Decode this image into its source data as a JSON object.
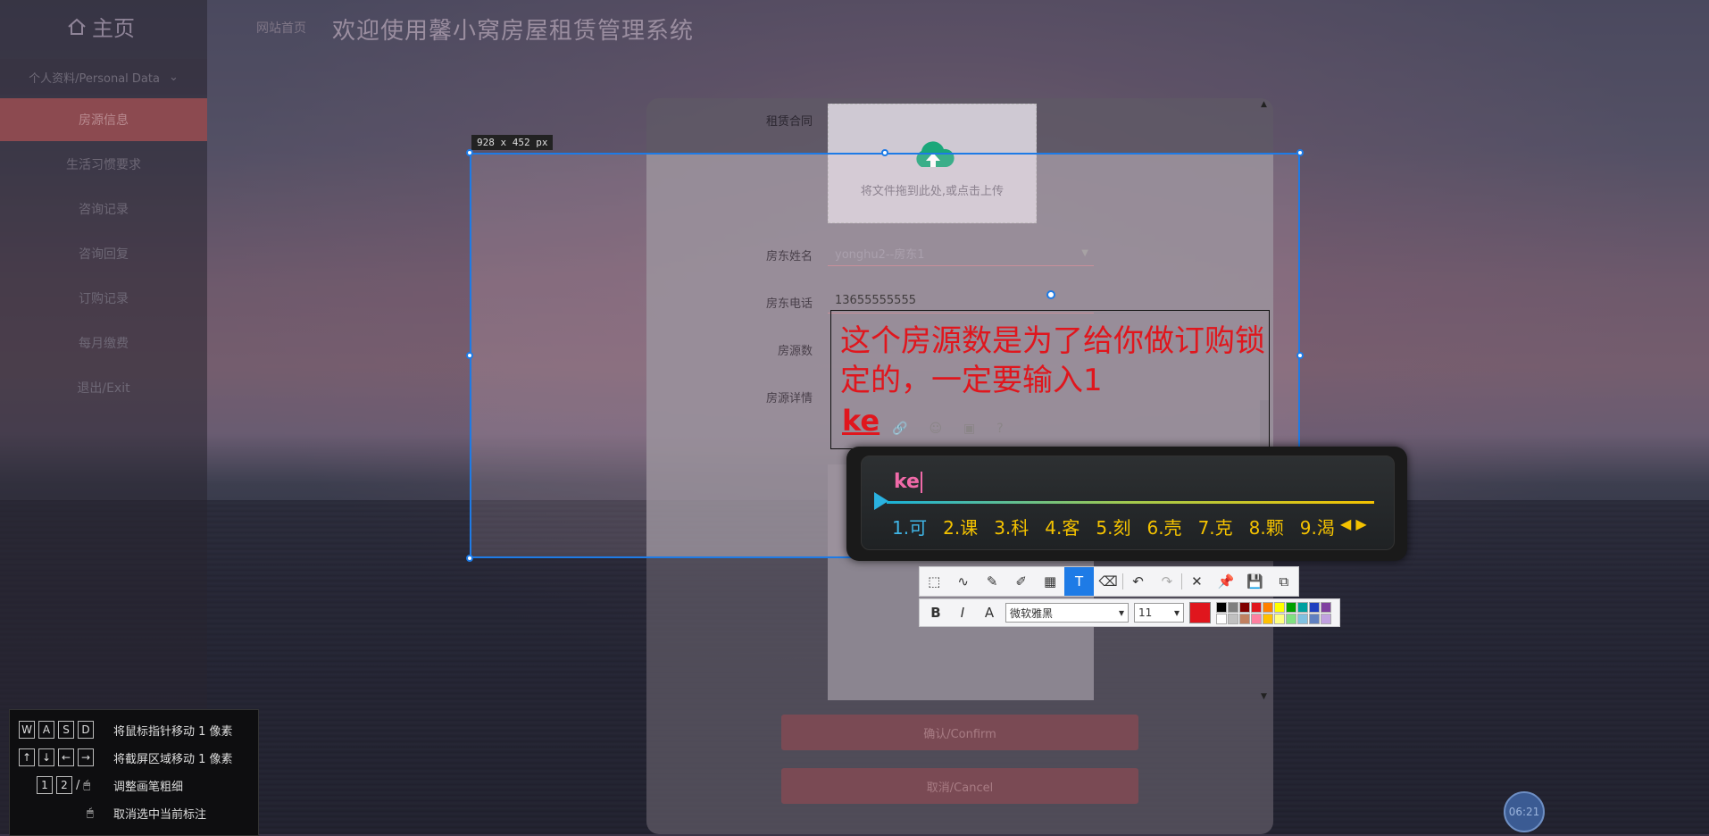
{
  "header": {
    "title": "欢迎使用馨小窝房屋租赁管理系统",
    "home_link": "网站首页"
  },
  "sidebar": {
    "home_label": "主页",
    "personal_label": "个人资料/Personal Data",
    "items": [
      {
        "label": "房源信息",
        "active": true
      },
      {
        "label": "生活习惯要求"
      },
      {
        "label": "咨询记录"
      },
      {
        "label": "咨询回复"
      },
      {
        "label": "订购记录"
      },
      {
        "label": "每月缴费"
      },
      {
        "label": "退出/Exit"
      }
    ]
  },
  "form": {
    "contract_label": "租赁合同",
    "upload_text": "将文件拖到此处,或点击上传",
    "landlord_name_label": "房东姓名",
    "landlord_name_value": "yonghu2--房东1",
    "landlord_phone_label": "房东电话",
    "landlord_phone_value": "13655555555",
    "house_count_label": "房源数",
    "house_detail_label": "房源详情",
    "confirm_label": "确认/Confirm",
    "cancel_label": "取消/Cancel"
  },
  "capture": {
    "size_label": "928 x 452  px",
    "annotation_text": "这个房源数是为了给你做订购锁定的，一定要输入1",
    "annotation_pending": "ke"
  },
  "ime": {
    "composition": "ke",
    "candidates": [
      "1.可",
      "2.课",
      "3.科",
      "4.客",
      "5.刻",
      "6.壳",
      "7.克",
      "8.颗",
      "9.渴"
    ]
  },
  "draw_toolbar": {
    "font_name": "微软雅黑",
    "font_size": "11",
    "current_color": "#e0161d",
    "palette": [
      "#000000",
      "#808080",
      "#800000",
      "#e0161d",
      "#ff8000",
      "#ffff00",
      "#00a000",
      "#00a0a0",
      "#2040c0",
      "#8040a0",
      "#ffffff",
      "#c0c0c0",
      "#c08060",
      "#ff80a0",
      "#ffc000",
      "#ffff80",
      "#80e080",
      "#80c0e0",
      "#6080c0",
      "#c0a0e0"
    ]
  },
  "hints": [
    {
      "keys": [
        "W",
        "A",
        "S",
        "D"
      ],
      "desc": "将鼠标指针移动 1 像素"
    },
    {
      "keys": [
        "↑",
        "↓",
        "←",
        "→"
      ],
      "desc": "将截屏区域移动 1 像素"
    },
    {
      "keys": [
        "1",
        "2",
        "/"
      ],
      "desc": "调整画笔粗细"
    },
    {
      "keys": [],
      "desc": "取消选中当前标注"
    }
  ],
  "clock": "06:21"
}
